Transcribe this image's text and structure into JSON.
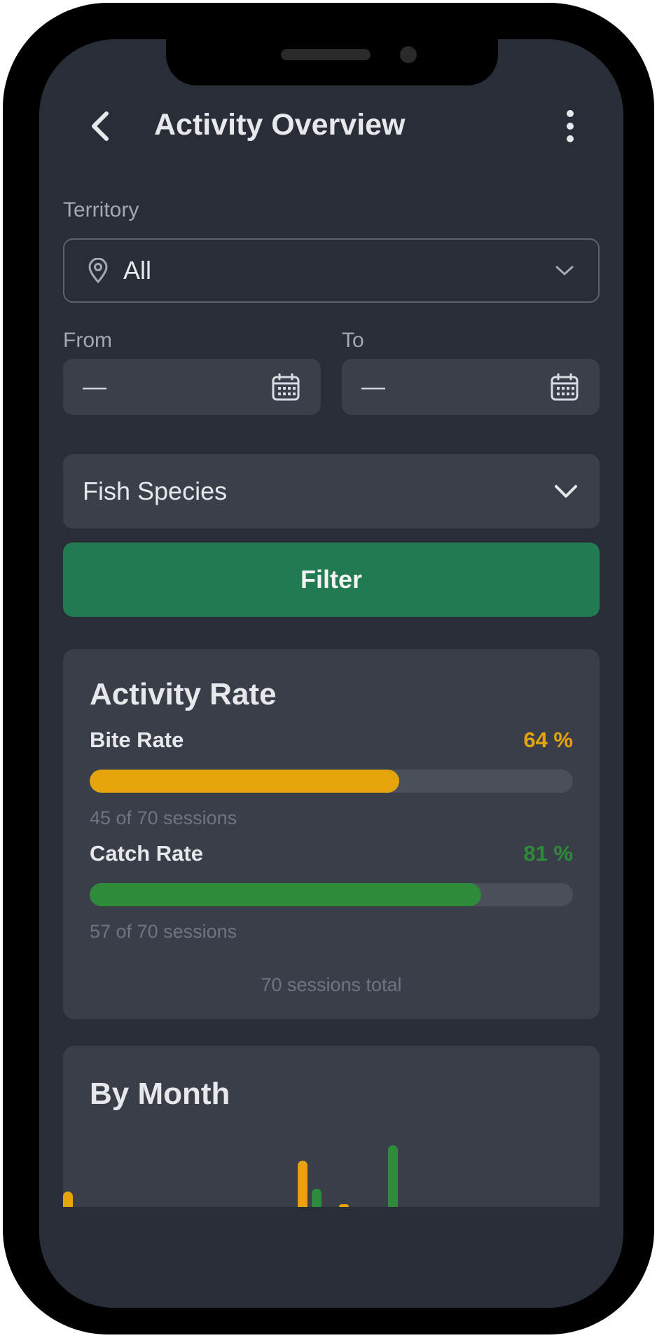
{
  "header": {
    "title": "Activity Overview"
  },
  "territory": {
    "label": "Territory",
    "value": "All"
  },
  "date_range": {
    "from_label": "From",
    "from_value": "—",
    "to_label": "To",
    "to_value": "—"
  },
  "species": {
    "value": "Fish Species"
  },
  "filter_button": {
    "label": "Filter"
  },
  "activity_rate": {
    "title": "Activity Rate",
    "metrics": [
      {
        "name": "Bite Rate",
        "percent_label": "64 %",
        "fraction": 0.64,
        "detail": "45 of 70 sessions",
        "color": "#e5a50a"
      },
      {
        "name": "Catch Rate",
        "percent_label": "81 %",
        "fraction": 0.81,
        "detail": "57 of 70 sessions",
        "color": "#2e8b3a"
      }
    ],
    "total": "70 sessions total"
  },
  "by_month": {
    "title": "By Month"
  },
  "chart_data": {
    "type": "bar",
    "series": [
      {
        "values": [
          3,
          1,
          0.2,
          0
        ],
        "color": "#e5a50a"
      },
      {
        "values": [
          1.2,
          0,
          0,
          4
        ],
        "color": "#2e8b3a"
      }
    ]
  },
  "icons": {
    "back": "chevron-left-icon",
    "more": "more-vertical-icon",
    "pin": "map-pin-icon",
    "dropdown": "chevron-down-icon",
    "calendar": "calendar-icon"
  }
}
